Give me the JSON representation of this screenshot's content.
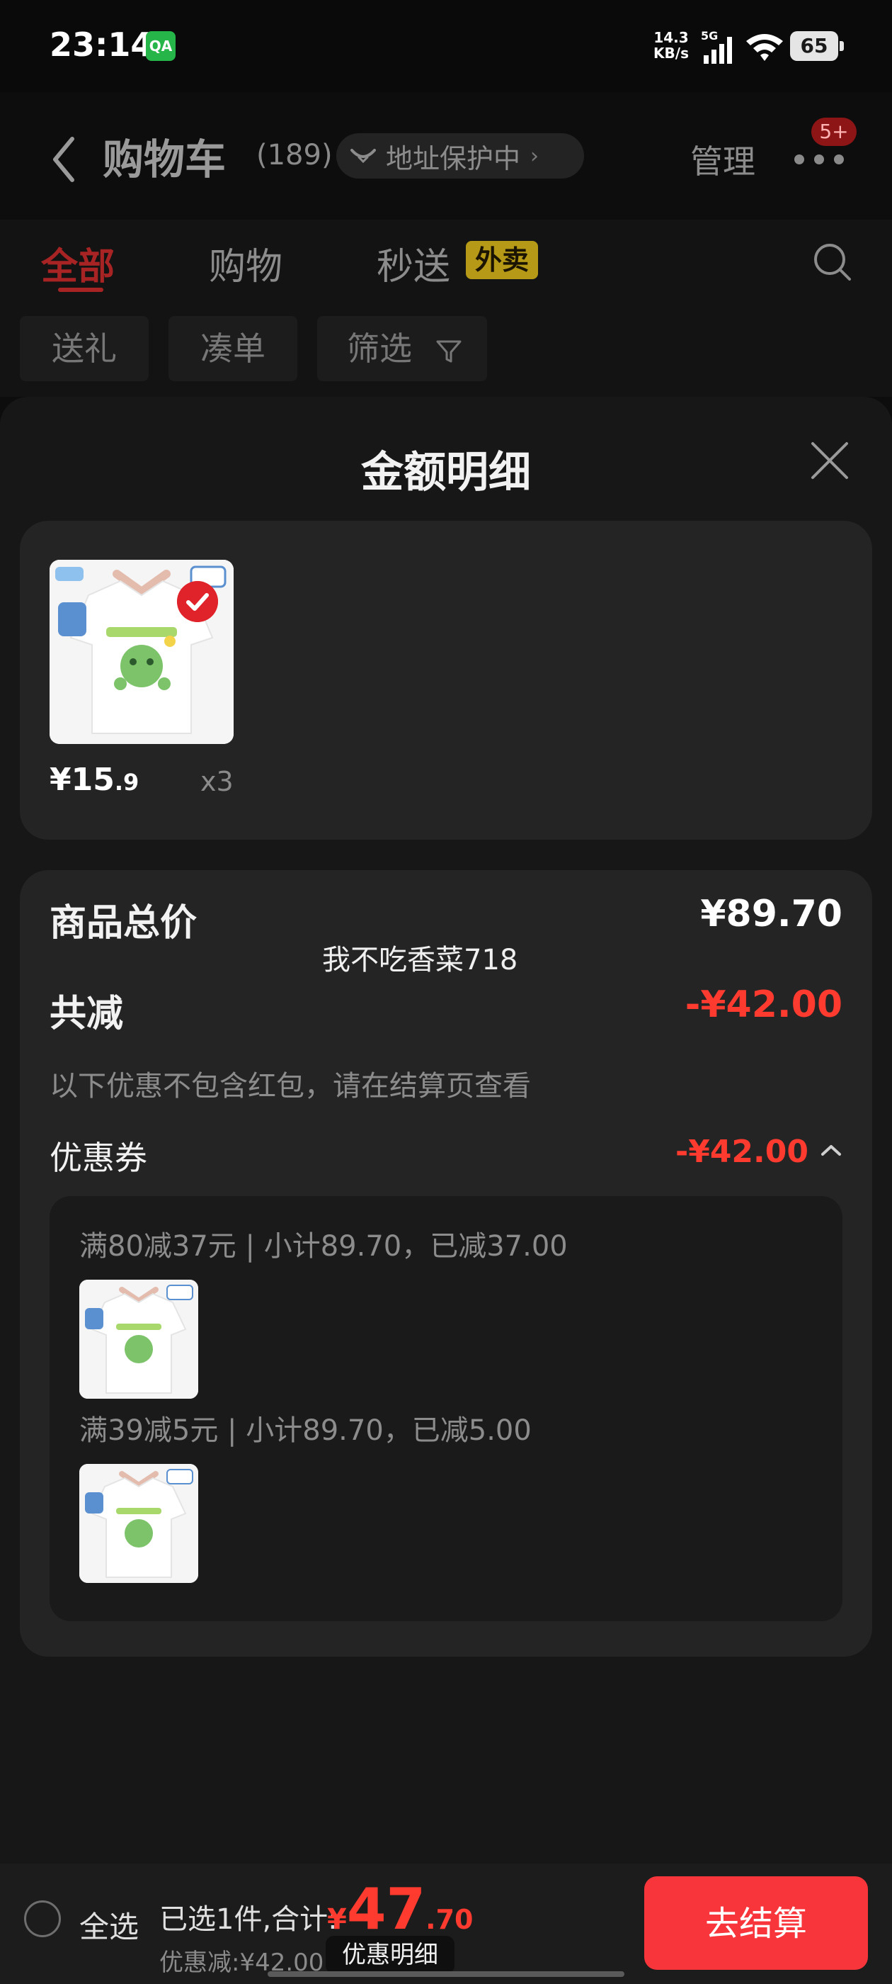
{
  "status_bar": {
    "time": "23:14",
    "app_icon_label": "QA",
    "net_speed_value": "14.3",
    "net_speed_unit": "KB/s",
    "network": "5G",
    "battery": "65"
  },
  "header": {
    "title": "购物车",
    "count": "(189)",
    "address_label": "地址保护中",
    "manage": "管理",
    "more_badge": "5+"
  },
  "tabs": {
    "all": "全部",
    "shopping": "购物",
    "express": "秒送",
    "express_badge": "外卖"
  },
  "filters": {
    "gift": "送礼",
    "bundle": "凑单",
    "filter": "筛选"
  },
  "sheet": {
    "title": "金额明细",
    "product": {
      "price_main": "¥15",
      "price_decimal": ".9",
      "quantity": "x3"
    },
    "summary": {
      "total_label": "商品总价",
      "total_value": "¥89.70",
      "discount_label": "共减",
      "discount_value": "-¥42.00",
      "note": "以下优惠不包含红包，请在结算页查看",
      "coupon_label": "优惠券",
      "coupon_value": "-¥42.00"
    },
    "coupons": [
      {
        "text": "满80减37元 | 小计89.70，已减37.00"
      },
      {
        "text": "满39减5元 | 小计89.70，已减5.00"
      }
    ]
  },
  "watermark": "我不吃香菜718",
  "bottom_bar": {
    "select_all": "全选",
    "selected_text": "已选1件,合计:",
    "total_yen": "¥",
    "total_int": "47",
    "total_dec": ".70",
    "discount_text": "优惠减:¥42.00",
    "detail_button": "优惠明细",
    "checkout_button": "去结算"
  },
  "colors": {
    "accent_red": "#ff3b30",
    "checkout_red": "#f7353b",
    "tab_active": "#a82424",
    "waimai_badge": "#b69a17"
  },
  "icons": [
    "back-arrow-icon",
    "shield-icon",
    "chevron-right-icon",
    "more-dots-icon",
    "search-icon",
    "filter-funnel-icon",
    "close-icon",
    "check-icon",
    "chevron-up-icon",
    "radio-icon"
  ]
}
